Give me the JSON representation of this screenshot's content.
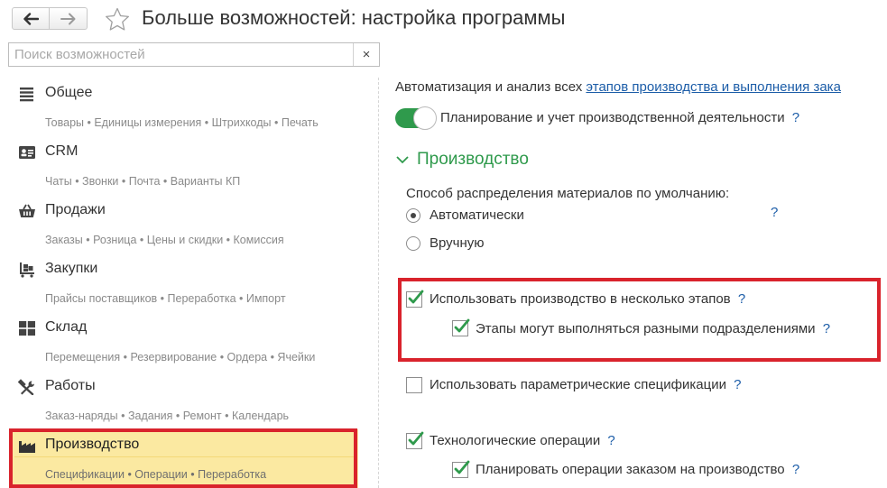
{
  "header": {
    "back_icon": "arrow-left-icon",
    "forward_icon": "arrow-right-icon",
    "favorite_icon": "star-icon",
    "title": "Больше возможностей: настройка программы"
  },
  "search": {
    "placeholder": "Поиск возможностей",
    "value": "",
    "clear_label": "×"
  },
  "sidebar": {
    "items": [
      {
        "icon": "list-icon",
        "label": "Общее",
        "sub": "Товары • Единицы измерения • Штрихкоды • Печать"
      },
      {
        "icon": "contact-card-icon",
        "label": "CRM",
        "sub": "Чаты • Звонки • Почта • Варианты КП"
      },
      {
        "icon": "shopping-basket-icon",
        "label": "Продажи",
        "sub": "Заказы • Розница • Цены и скидки • Комиссия"
      },
      {
        "icon": "cart-icon",
        "label": "Закупки",
        "sub": "Прайсы поставщиков • Переработка • Импорт"
      },
      {
        "icon": "warehouse-icon",
        "label": "Склад",
        "sub": "Перемещения • Резервирование • Ордера • Ячейки"
      },
      {
        "icon": "tools-icon",
        "label": "Работы",
        "sub": "Заказ-наряды • Задания • Ремонт • Календарь"
      },
      {
        "icon": "factory-icon",
        "label": "Производство",
        "sub": "Спецификации • Операции • Переработка",
        "active": true
      }
    ]
  },
  "main": {
    "intro_text": "Автоматизация и анализ всех ",
    "intro_link": "этапов производства и выполнения зака",
    "toggle": {
      "label": "Планирование и учет производственной деятельности",
      "on": true,
      "help": "?"
    },
    "section": {
      "title": "Производство",
      "expanded": true
    },
    "distribution": {
      "label": "Способ распределения материалов по умолчанию:",
      "options": [
        {
          "label": "Автоматически",
          "selected": true
        },
        {
          "label": "Вручную",
          "selected": false
        }
      ],
      "help": "?"
    },
    "checkboxes": [
      {
        "label": "Использовать производство в несколько этапов",
        "checked": true,
        "help": "?"
      },
      {
        "label": "Этапы могут выполняться разными подразделениями",
        "checked": true,
        "help": "?"
      },
      {
        "label": "Использовать параметрические спецификации",
        "checked": false,
        "help": "?"
      },
      {
        "label": "Технологические операции",
        "checked": true,
        "help": "?"
      },
      {
        "label": "Планировать операции заказом на производство",
        "checked": true,
        "help": "?"
      }
    ]
  },
  "colors": {
    "accent_green": "#2f9a4c",
    "link_blue": "#1c5da8",
    "highlight_red": "#d9232c",
    "active_item_bg": "#fbe9a1"
  }
}
